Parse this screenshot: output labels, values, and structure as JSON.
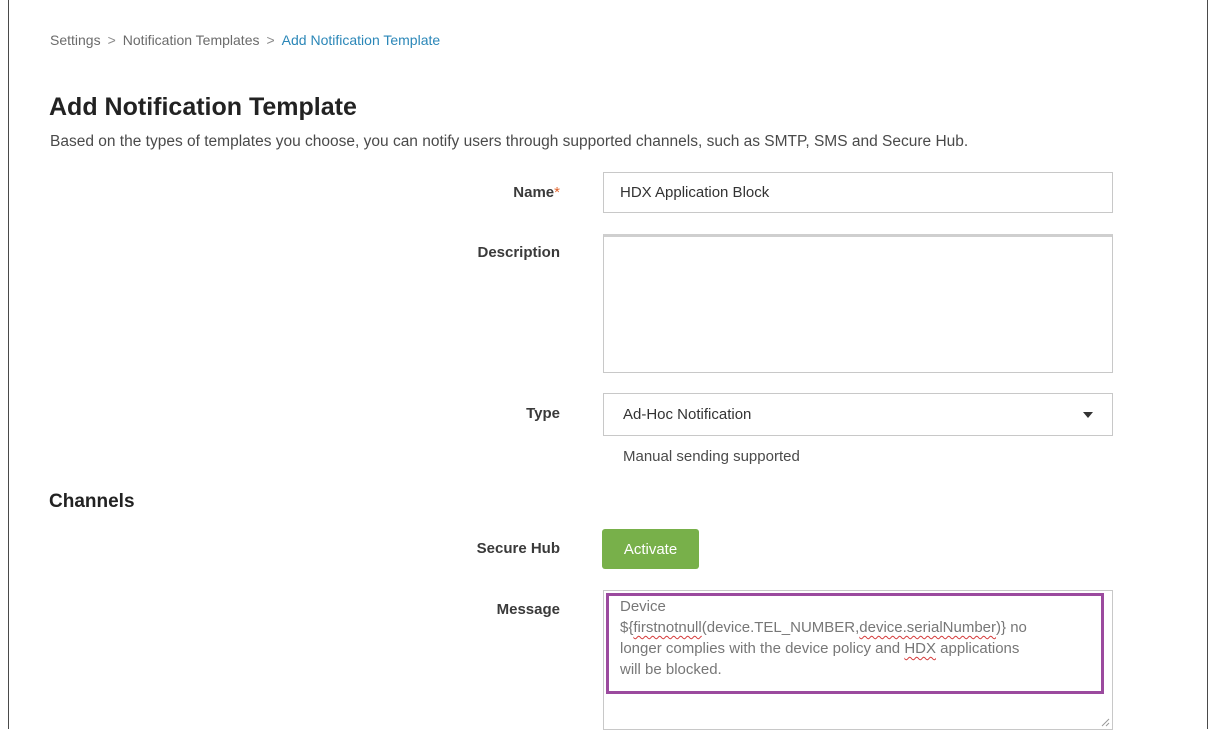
{
  "breadcrumb": {
    "items": [
      "Settings",
      "Notification Templates",
      "Add Notification Template"
    ],
    "separator": ">"
  },
  "page": {
    "title": "Add Notification Template",
    "description": "Based on the types of templates you choose, you can notify users through supported channels, such as SMTP, SMS and Secure Hub."
  },
  "form": {
    "name_label": "Name",
    "required_marker": "*",
    "name_value": "HDX Application Block",
    "description_label": "Description",
    "description_value": "",
    "type_label": "Type",
    "type_value": "Ad-Hoc Notification",
    "type_helper": "Manual sending supported"
  },
  "channels": {
    "title": "Channels",
    "secure_hub_label": "Secure Hub",
    "activate_label": "Activate",
    "message_label": "Message",
    "message": {
      "line1": "Device",
      "line2_prefix": "${",
      "line2_fn": "firstnotnull",
      "line2_mid": "(device.TEL_NUMBER,",
      "line2_arg": "device.serialNumber",
      "line2_suffix": ")} no",
      "line3_prefix": "longer complies with the device policy and ",
      "line3_hdx": "HDX",
      "line3_suffix": " applications",
      "line4": "will be blocked."
    }
  },
  "colors": {
    "accent_link": "#2b87b8",
    "activate_button": "#78b04a",
    "highlight_border": "#9b4a9e",
    "required": "#e0622b"
  },
  "icons": {
    "type_select": "chevron-down-icon",
    "textarea_resize": "resize-grip-icon"
  }
}
